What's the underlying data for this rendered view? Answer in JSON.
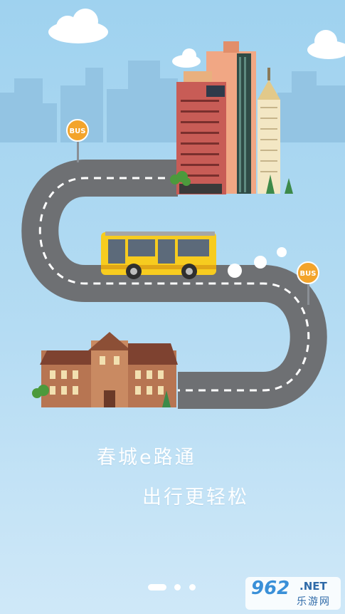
{
  "signs": {
    "bus_sign_top": "BUS",
    "bus_sign_right": "BUS"
  },
  "slogan": {
    "line1": "春城e路通",
    "line2": "出行更轻松"
  },
  "pagination": {
    "page_count": 3,
    "current_page": 1
  },
  "watermark": {
    "number": "962",
    "suffix": ".NET",
    "cn": "乐游网"
  },
  "colors": {
    "sky_top": "#9fd2ef",
    "road": "#6e7073",
    "bus_yellow": "#f7cc1f",
    "sign_orange": "#f3a42b",
    "school_brick": "#b77552"
  }
}
